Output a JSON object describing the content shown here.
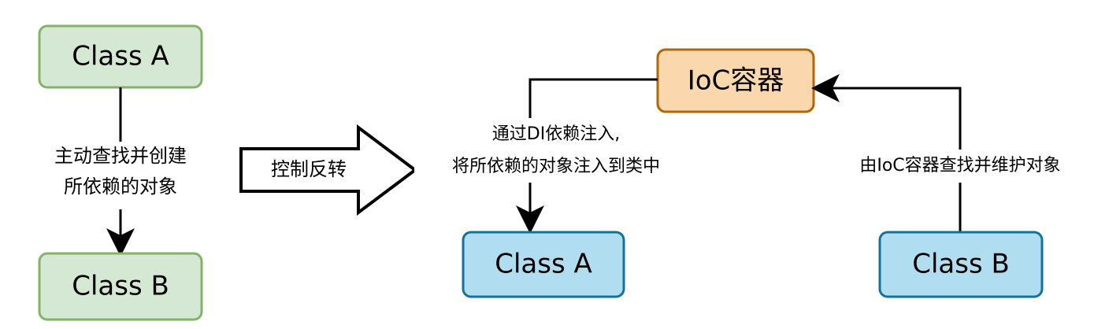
{
  "left": {
    "class_a": "Class A",
    "class_b": "Class B",
    "edge_label_line1": "主动查找并创建",
    "edge_label_line2": "所依赖的对象"
  },
  "middle": {
    "arrow_label": "控制反转"
  },
  "right": {
    "ioc": "IoC容器",
    "class_a": "Class A",
    "class_b": "Class B",
    "inject_label_line1": "通过DI依赖注入,",
    "inject_label_line2": "将所依赖的对象注入到类中",
    "maintain_label": "由IoC容器查找并维护对象"
  },
  "colors": {
    "green_fill": "#d5e8d4",
    "green_stroke": "#82b366",
    "blue_fill": "#b1ddf0",
    "blue_stroke": "#10739e",
    "orange_fill": "#fad7ac",
    "orange_stroke": "#b46504"
  }
}
